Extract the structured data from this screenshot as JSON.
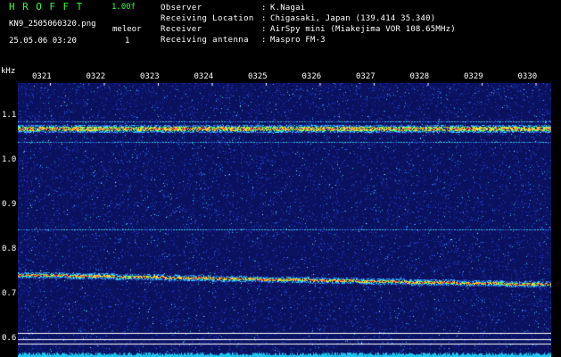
{
  "header": {
    "app_name": "HROFFT",
    "version": "1.00f",
    "filename": "KN9_2505060320.png",
    "mode": "meleor",
    "timestamp": "25.05.06 03:20",
    "count": "1"
  },
  "station": [
    {
      "label": "Observer",
      "value": "K.Nagai"
    },
    {
      "label": "Receiving Location",
      "value": "Chigasaki, Japan (139.414 35.340)"
    },
    {
      "label": "Receiver",
      "value": "AirSpy mini (Miakejima VOR 108.65MHz)"
    },
    {
      "label": "Receiving antenna",
      "value": "Maspro FM-3"
    }
  ],
  "spectrogram": {
    "y_unit": "kHz",
    "x_ticks": [
      "0321",
      "0322",
      "0323",
      "0324",
      "0325",
      "0326",
      "0327",
      "0328",
      "0329",
      "0330"
    ],
    "y_ticks": [
      "1.1",
      "1.0",
      "0.9",
      "0.8",
      "0.7",
      "0.6"
    ],
    "colors": {
      "background": "#000000",
      "noise": "#1a2a9e",
      "signal": "#ff4040",
      "baseline": "#19c8f0"
    }
  }
}
